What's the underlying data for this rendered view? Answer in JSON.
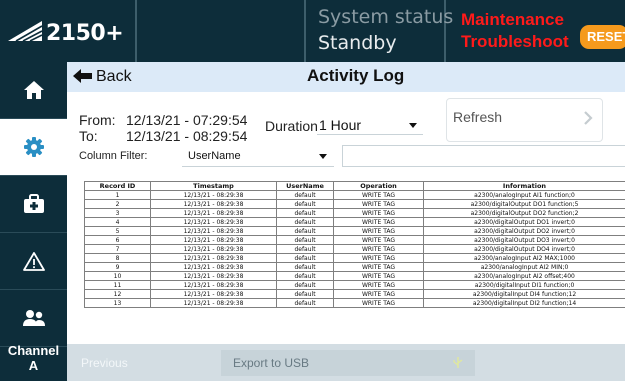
{
  "header": {
    "model": "2150+",
    "status_label": "System status",
    "status_value": "Standby",
    "alert_line1": "Maintenance",
    "alert_line2": "Troubleshoot",
    "reset_label": "RESET",
    "alert_color": "#ff1a1a",
    "reset_color": "#f59a1d"
  },
  "sidebar": {
    "items": [
      {
        "icon": "home-icon"
      },
      {
        "icon": "gear-icon",
        "active": true
      },
      {
        "icon": "toolbox-icon"
      },
      {
        "icon": "warning-icon"
      },
      {
        "icon": "users-icon"
      }
    ],
    "channel_label": "Channel",
    "channel_value": "A"
  },
  "topbar": {
    "back_label": "Back",
    "title": "Activity Log"
  },
  "filters": {
    "from_label": "From:",
    "from_value": "12/13/21 - 07:29:54",
    "to_label": "To:",
    "to_value": "12/13/21 - 08:29:54",
    "duration_label": "Duration:",
    "duration_value": "1 Hour",
    "refresh_label": "Refresh",
    "column_filter_label": "Column Filter:",
    "column_filter_value": "UserName",
    "filter_text": ""
  },
  "table": {
    "columns": [
      "Record ID",
      "Timestamp",
      "UserName",
      "Operation",
      "Information"
    ],
    "rows": [
      [
        "1",
        "12/13/21 - 08:29:38",
        "default",
        "WRITE TAG",
        "a2300/analogInput AI1 function;0"
      ],
      [
        "2",
        "12/13/21 - 08:29:38",
        "default",
        "WRITE TAG",
        "a2300/digitalOutput DO1 function;5"
      ],
      [
        "3",
        "12/13/21 - 08:29:38",
        "default",
        "WRITE TAG",
        "a2300/digitalOutput DO2 function;2"
      ],
      [
        "4",
        "12/13/21 - 08:29:38",
        "default",
        "WRITE TAG",
        "a2300/digitalOutput DO1 invert;0"
      ],
      [
        "5",
        "12/13/21 - 08:29:38",
        "default",
        "WRITE TAG",
        "a2300/digitalOutput DO2 invert;0"
      ],
      [
        "6",
        "12/13/21 - 08:29:38",
        "default",
        "WRITE TAG",
        "a2300/digitalOutput DO3 invert;0"
      ],
      [
        "7",
        "12/13/21 - 08:29:38",
        "default",
        "WRITE TAG",
        "a2300/digitalOutput DO4 invert;0"
      ],
      [
        "8",
        "12/13/21 - 08:29:38",
        "default",
        "WRITE TAG",
        "a2300/analogInput AI2 MAX;1000"
      ],
      [
        "9",
        "12/13/21 - 08:29:38",
        "default",
        "WRITE TAG",
        "a2300/analogInput AI2 MIN;0"
      ],
      [
        "10",
        "12/13/21 - 08:29:38",
        "default",
        "WRITE TAG",
        "a2300/analogInput AI2 offset;400"
      ],
      [
        "11",
        "12/13/21 - 08:29:38",
        "default",
        "WRITE TAG",
        "a2300/digitalInput DI1 function;0"
      ],
      [
        "12",
        "12/13/21 - 08:29:38",
        "default",
        "WRITE TAG",
        "a2300/digitalInput DI4 function;12"
      ],
      [
        "13",
        "12/13/21 - 08:29:38",
        "default",
        "WRITE TAG",
        "a2300/digitalInput DI2 function;14"
      ]
    ]
  },
  "bottombar": {
    "previous_label": "Previous",
    "export_label": "Export to USB",
    "export_icon": "usb-icon"
  }
}
